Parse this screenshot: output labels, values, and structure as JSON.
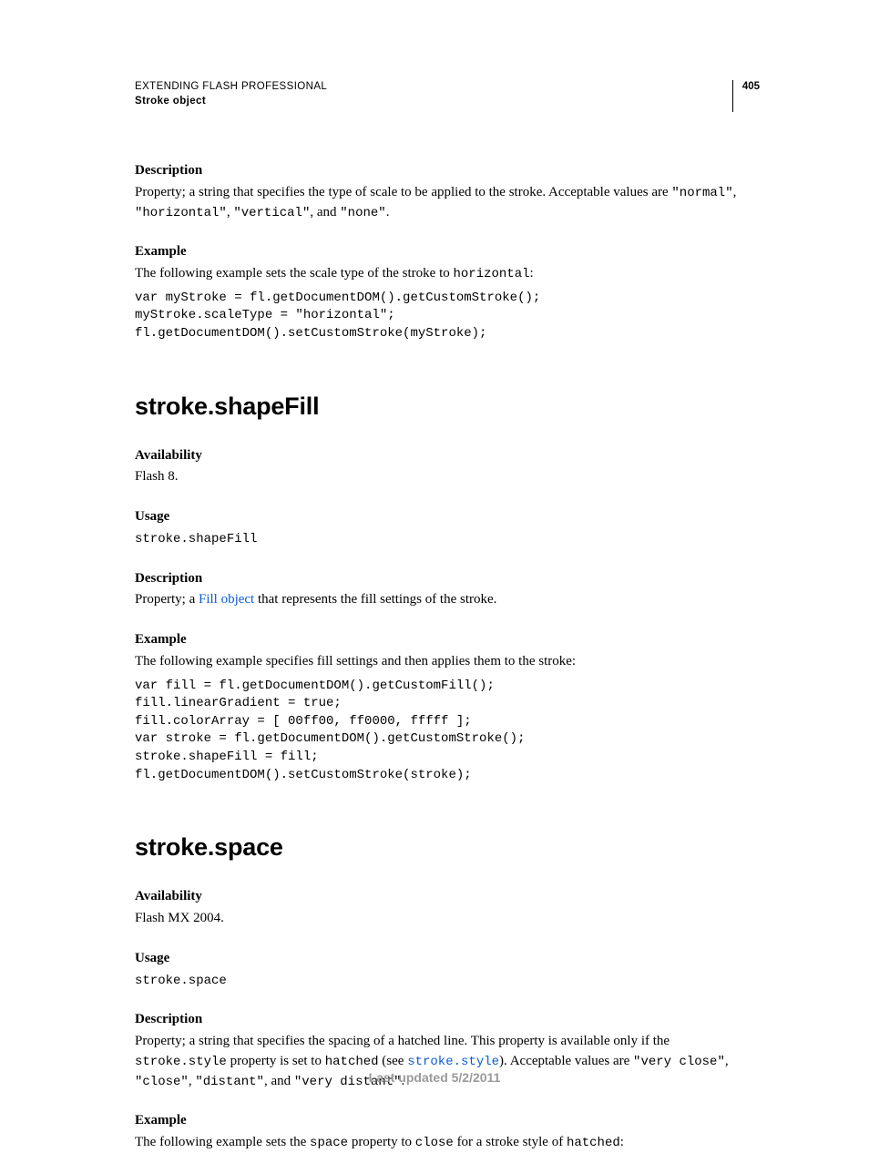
{
  "header": {
    "line1": "EXTENDING FLASH PROFESSIONAL",
    "line2": "Stroke object",
    "page_number": "405"
  },
  "section1": {
    "description_head": "Description",
    "description_t1": "Property; a string that specifies the type of scale to be applied to the stroke. Acceptable values are ",
    "v_normal": "\"normal\"",
    "description_comma1": ", ",
    "v_horizontal": "\"horizontal\"",
    "description_comma2": ", ",
    "v_vertical": "\"vertical\"",
    "description_and": ", and ",
    "v_none": "\"none\"",
    "description_period": ".",
    "example_head": "Example",
    "example_t1": "The following example sets the scale type of the stroke to ",
    "example_c1": "horizontal",
    "example_colon": ":",
    "codeblock": "var myStroke = fl.getDocumentDOM().getCustomStroke();\nmyStroke.scaleType = \"horizontal\";\nfl.getDocumentDOM().setCustomStroke(myStroke);"
  },
  "section2": {
    "title": "stroke.shapeFill",
    "availability_head": "Availability",
    "availability_text": "Flash 8.",
    "usage_head": "Usage",
    "usage_code": "stroke.shapeFill",
    "description_head": "Description",
    "desc_t1": "Property; a ",
    "desc_link": "Fill object",
    "desc_t2": " that represents the fill settings of the stroke.",
    "example_head": "Example",
    "example_text": "The following example specifies fill settings and then applies them to the stroke:",
    "codeblock": "var fill = fl.getDocumentDOM().getCustomFill();\nfill.linearGradient = true;\nfill.colorArray = [ 00ff00, ff0000, fffff ];\nvar stroke = fl.getDocumentDOM().getCustomStroke();\nstroke.shapeFill = fill;\nfl.getDocumentDOM().setCustomStroke(stroke);"
  },
  "section3": {
    "title": "stroke.space",
    "availability_head": "Availability",
    "availability_text": "Flash MX 2004.",
    "usage_head": "Usage",
    "usage_code": "stroke.space",
    "description_head": "Description",
    "d_t1": "Property; a string that specifies the spacing of a hatched line. This property is available only if the ",
    "d_c1": "stroke.style",
    "d_t2": " property is set to ",
    "d_c2": "hatched",
    "d_t3": " (see ",
    "d_link": "stroke.style",
    "d_t4": "). Acceptable values are ",
    "d_v1": "\"very close\"",
    "d_comma1": ", ",
    "d_v2": "\"close\"",
    "d_comma2": ", ",
    "d_v3": "\"distant\"",
    "d_and": ", and ",
    "d_v4": "\"very distant\"",
    "d_period": ".",
    "example_head": "Example",
    "ex_t1": "The following example sets the ",
    "ex_c1": "space",
    "ex_t2": " property to ",
    "ex_c2": "close",
    "ex_t3": " for a stroke style of ",
    "ex_c3": "hatched",
    "ex_colon": ":"
  },
  "footer": {
    "text": "Last updated 5/2/2011"
  }
}
